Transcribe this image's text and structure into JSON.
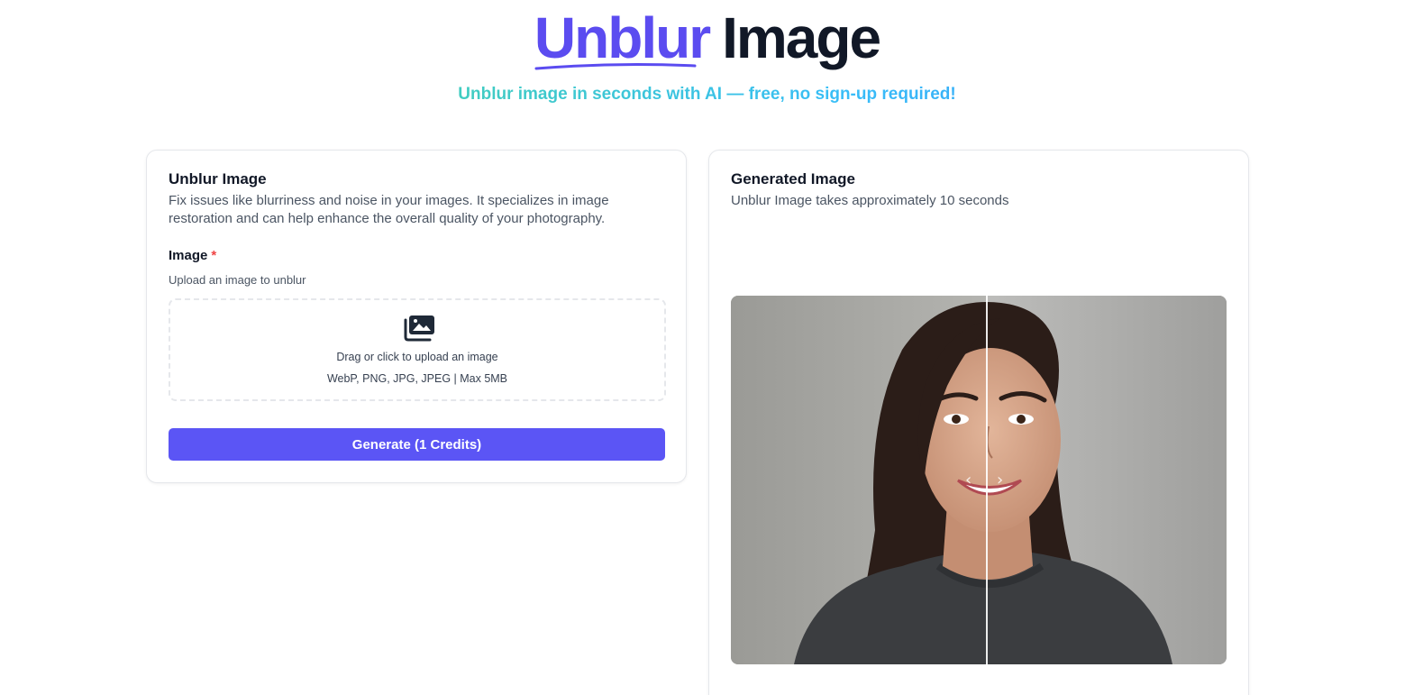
{
  "hero": {
    "title_accent": "Unblur",
    "title_plain": "Image",
    "subtitle": "Unblur image in seconds with AI — free, no sign-up required!"
  },
  "input_card": {
    "title": "Unblur Image",
    "description": "Fix issues like blurriness and noise in your images. It specializes in image restoration and can help enhance the overall quality of your photography.",
    "field_label": "Image",
    "required_mark": "*",
    "field_help": "Upload an image to unblur",
    "dropzone_icon": "images-icon",
    "dropzone_text": "Drag or click to upload an image",
    "dropzone_formats": "WebP, PNG, JPG, JPEG | Max 5MB",
    "generate_label": "Generate (1 Credits)"
  },
  "output_card": {
    "title": "Generated Image",
    "subtitle": "Unblur Image takes approximately 10 seconds",
    "compare_handle_left": "‹",
    "compare_handle_right": "›",
    "compare_split": 0.515
  },
  "colors": {
    "accent": "#5b4cf0",
    "button": "#5b55f5",
    "required": "#ef4444",
    "subtitle_gradient": [
      "#4ade80",
      "#38bdf8",
      "#3b82f6"
    ]
  }
}
